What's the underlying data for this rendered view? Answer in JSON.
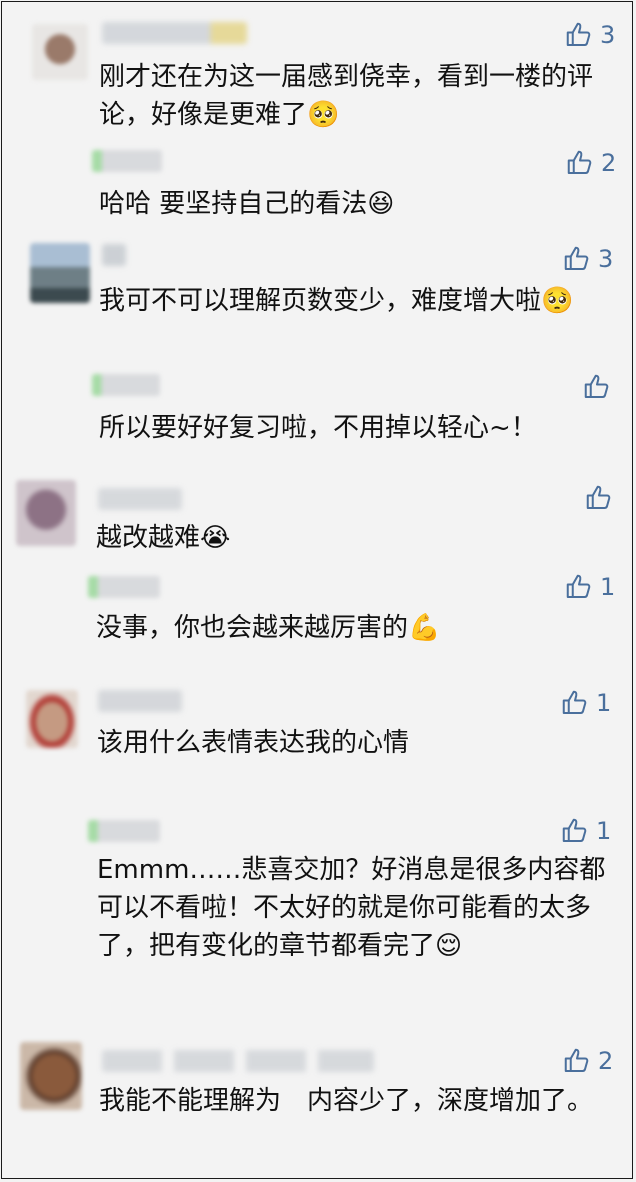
{
  "comments": [
    {
      "likes": "3",
      "text": "刚才还在为这一届感到侥幸，看到一楼的评论，好像是更难了🥺",
      "reply": {
        "likes": "2",
        "text": "哈哈 要坚持自己的看法😆"
      }
    },
    {
      "likes": "3",
      "text": "我可不可以理解页数变少，难度增大啦🥺",
      "reply": {
        "likes": "",
        "text": "所以要好好复习啦，不用掉以轻心~！"
      }
    },
    {
      "likes": "",
      "text": "越改越难😭",
      "reply": {
        "likes": "1",
        "text": "没事，你也会越来越厉害的💪"
      }
    },
    {
      "likes": "1",
      "text": "该用什么表情表达我的心情",
      "reply": {
        "likes": "1",
        "text": "Emmm……悲喜交加？好消息是很多内容都可以不看啦！不太好的就是你可能看的太多了，把有变化的章节都看完了😌"
      }
    },
    {
      "likes": "2",
      "text": "我能不能理解为　内容少了，深度增加了。",
      "reply": null
    }
  ],
  "colors": {
    "background": "#f3f3f3",
    "like_blue": "#4a6f9c",
    "text": "#111111"
  },
  "icons": {
    "like": "thumbs-up-icon"
  }
}
